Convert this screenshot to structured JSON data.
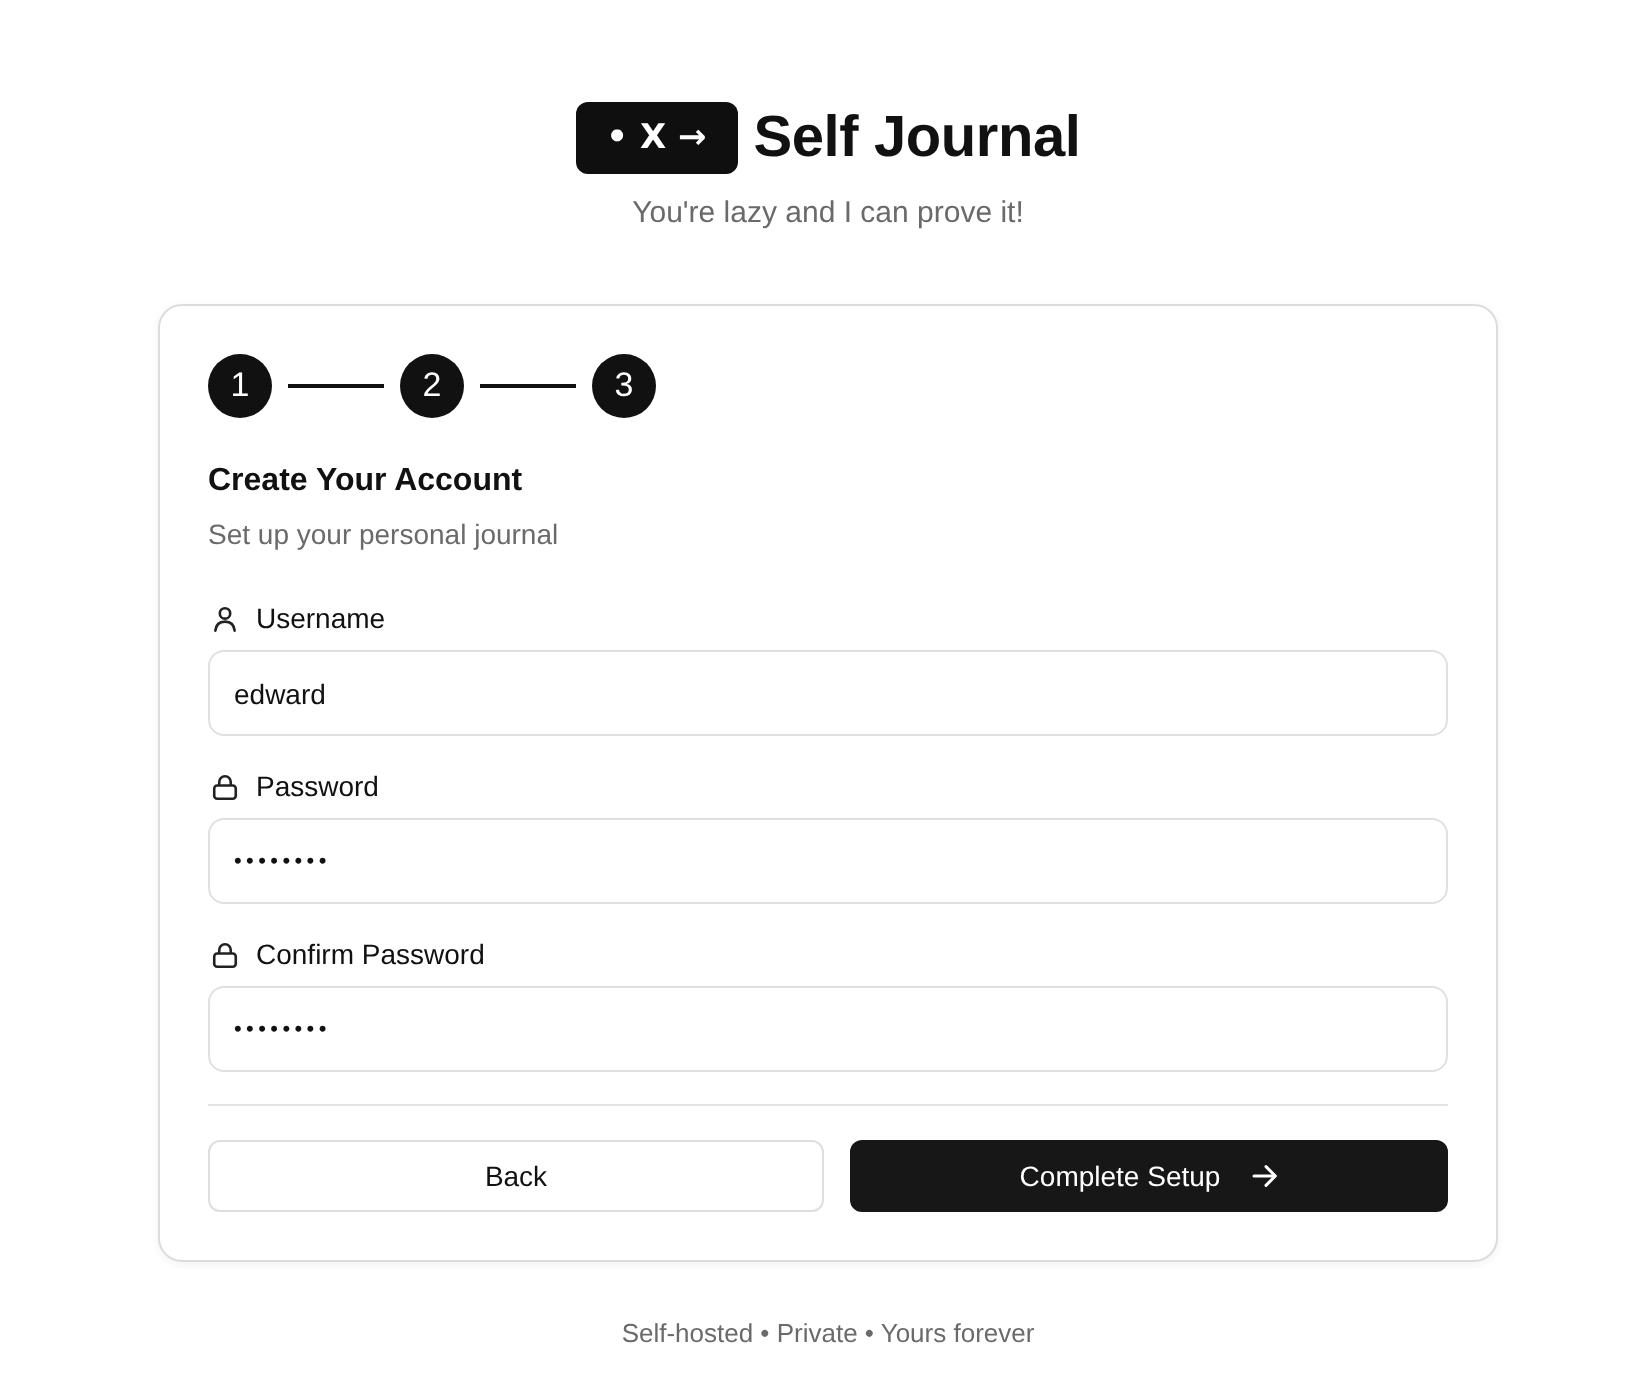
{
  "header": {
    "logo_mark": "• X →",
    "title": "Self Journal",
    "tagline": "You're lazy and I can prove it!"
  },
  "steps": [
    {
      "label": "1"
    },
    {
      "label": "2"
    },
    {
      "label": "3"
    }
  ],
  "form": {
    "heading": "Create Your Account",
    "subheading": "Set up your personal journal",
    "fields": [
      {
        "kind": "text",
        "label": "Username",
        "value": "edward"
      },
      {
        "kind": "password",
        "label": "Password",
        "value": "••••••••"
      },
      {
        "kind": "password",
        "label": "Confirm Password",
        "value": "••••••••"
      }
    ]
  },
  "buttons": [
    {
      "kind": "secondary",
      "label": "Back"
    },
    {
      "kind": "primary",
      "label": "Complete Setup"
    }
  ],
  "footer": "Self-hosted • Private • Yours forever"
}
